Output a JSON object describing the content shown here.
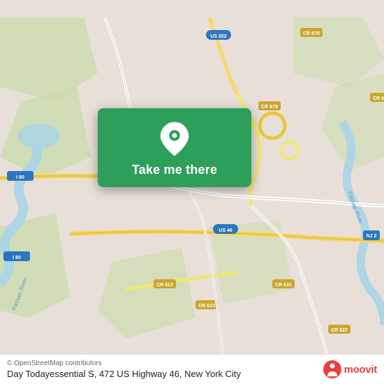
{
  "map": {
    "alt": "Map showing Day Todayessential S location"
  },
  "card": {
    "button_label": "Take me there",
    "pin_icon": "location-pin"
  },
  "bottom_bar": {
    "attribution": "© OpenStreetMap contributors",
    "location_name": "Day Todayessential S, 472 US Highway 46, New York City"
  },
  "moovit": {
    "text": "moovit"
  },
  "colors": {
    "card_green": "#2e9e5b",
    "moovit_red": "#e84040"
  }
}
